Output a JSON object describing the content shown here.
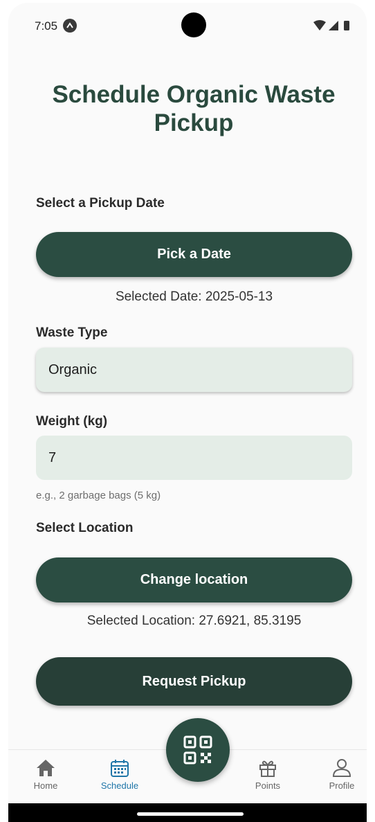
{
  "status_bar": {
    "time": "7:05"
  },
  "title": "Schedule Organic Waste Pickup",
  "date_section": {
    "label": "Select a Pickup Date",
    "button": "Pick a Date",
    "selected": "Selected Date: 2025-05-13"
  },
  "waste_type": {
    "label": "Waste Type",
    "value": "Organic"
  },
  "weight": {
    "label": "Weight (kg)",
    "value": "7",
    "hint": "e.g., 2 garbage bags (5 kg)"
  },
  "location": {
    "label": "Select Location",
    "button": "Change location",
    "selected": "Selected Location: 27.6921, 85.3195"
  },
  "request_button": "Request Pickup",
  "nav": {
    "items": [
      {
        "label": "Home",
        "icon": "home-icon",
        "active": false
      },
      {
        "label": "Schedule",
        "icon": "calendar-icon",
        "active": true
      },
      {
        "label": "Points",
        "icon": "gift-icon",
        "active": false
      },
      {
        "label": "Profile",
        "icon": "person-icon",
        "active": false
      }
    ],
    "fab_icon": "qr-code-icon"
  },
  "colors": {
    "primary": "#2b4d42",
    "field_bg": "#e4ede7",
    "active_nav": "#1f76a8"
  }
}
